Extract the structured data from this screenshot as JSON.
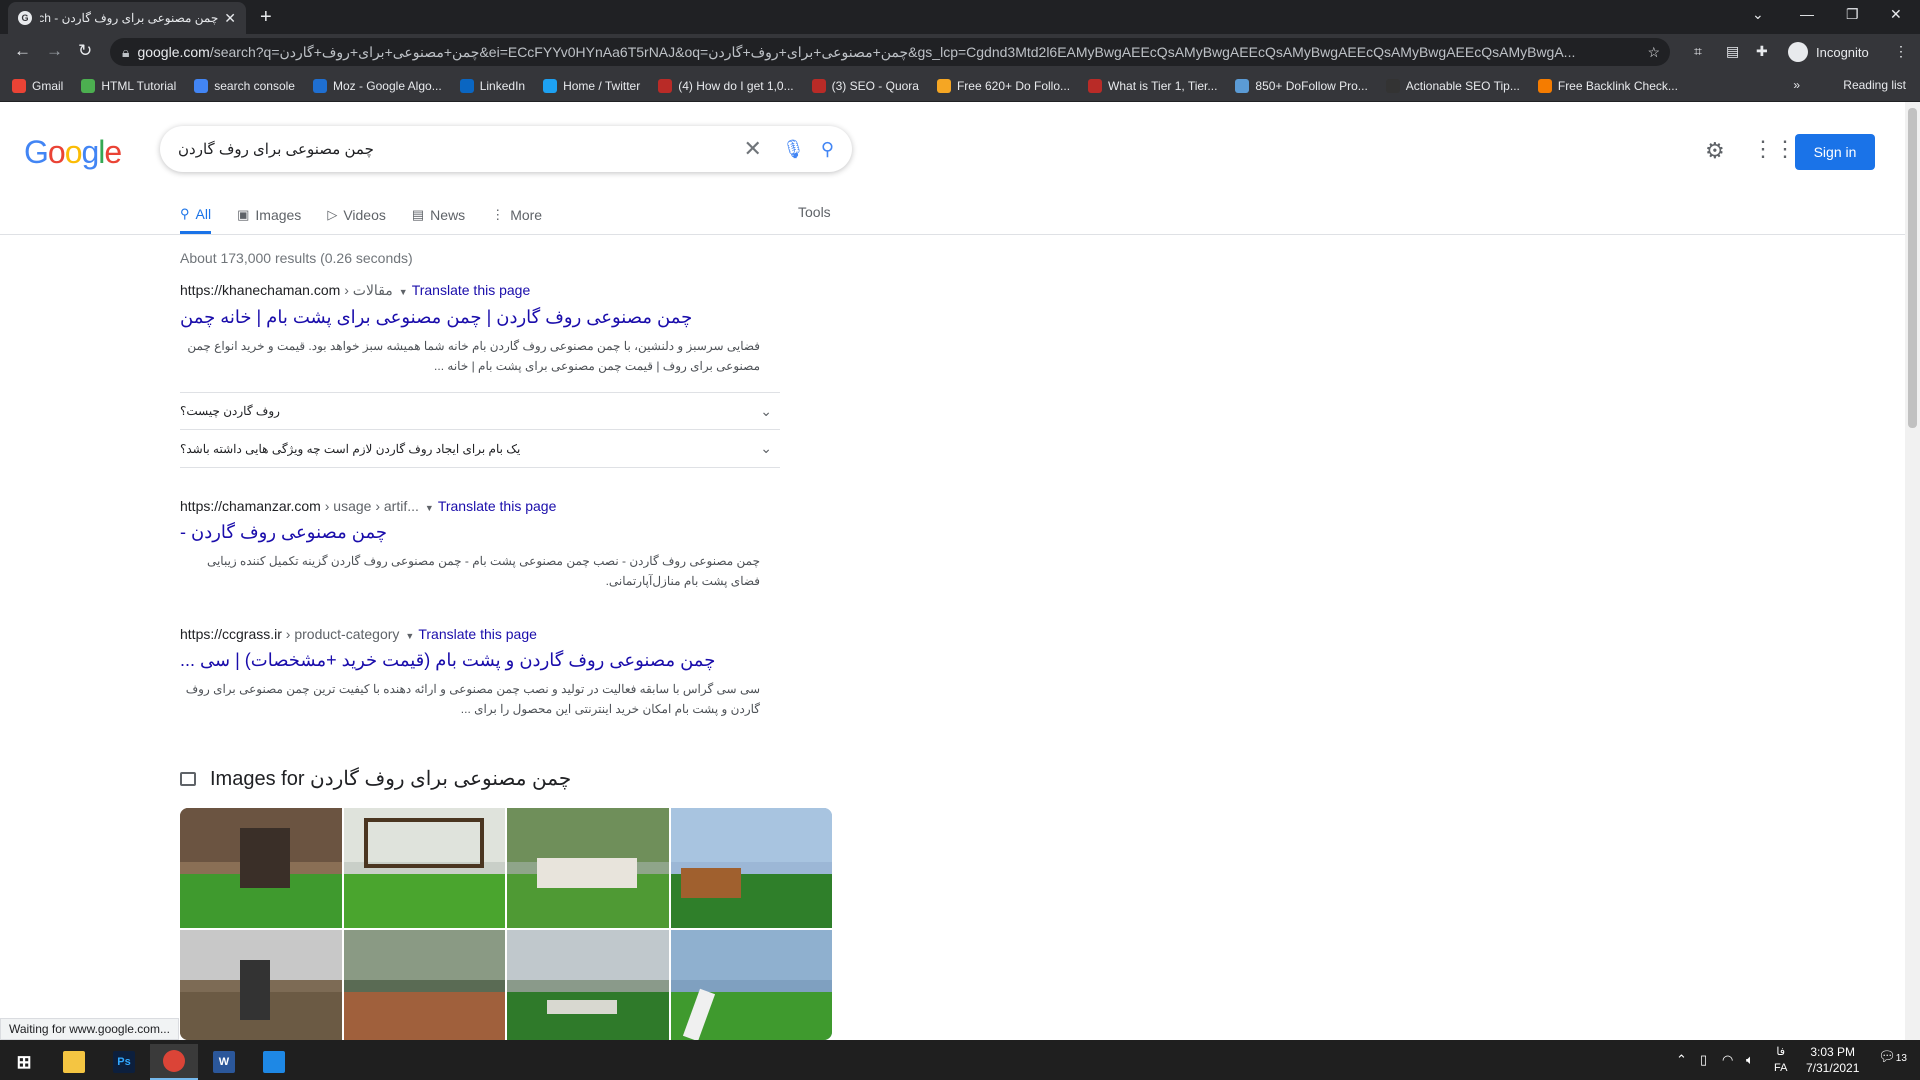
{
  "browser": {
    "tab_title": "چمن مصنوعی برای روف گاردن - ch",
    "tab_close": "✕",
    "new_tab": "+",
    "url_host": "google.com",
    "url_rest": "/search?q=چمن+مصنوعی+برای+روف+گاردن&ei=ECcFYYv0HYnAa6T5rNAJ&oq=چمن+مصنوعی+برای+روف+گاردن&gs_lcp=Cgdnd3Mtd2l6EAMyBwgAEEcQsAMyBwgAEEcQsAMyBwgAEEcQsAMyBwgAEEcQsAMyBwgA...",
    "profile": "Incognito",
    "reading_list": "Reading list",
    "bookmarks": [
      {
        "label": "Gmail",
        "color": "#ea4335"
      },
      {
        "label": "HTML Tutorial",
        "color": "#4caf50"
      },
      {
        "label": "search console",
        "color": "#4285f4"
      },
      {
        "label": "Moz - Google Algo...",
        "color": "#1f6fd1"
      },
      {
        "label": "LinkedIn",
        "color": "#0a66c2"
      },
      {
        "label": "Home / Twitter",
        "color": "#1da1f2"
      },
      {
        "label": "(4) How do I get 1,0...",
        "color": "#b92b27"
      },
      {
        "label": "(3) SEO - Quora",
        "color": "#b92b27"
      },
      {
        "label": "Free 620+ Do Follo...",
        "color": "#f5a623"
      },
      {
        "label": "What is Tier 1, Tier...",
        "color": "#b92b27"
      },
      {
        "label": "850+ DoFollow Pro...",
        "color": "#5b9bd5"
      },
      {
        "label": "Actionable SEO Tip...",
        "color": "#333333"
      },
      {
        "label": "Free Backlink Check...",
        "color": "#f57c00"
      }
    ]
  },
  "google": {
    "logo": "Google",
    "query": "چمن مصنوعی برای روف گاردن",
    "sign_in": "Sign in",
    "tabs": [
      "All",
      "Images",
      "Videos",
      "News",
      "More"
    ],
    "tools": "Tools",
    "stats": "About 173,000 results (0.26 seconds)"
  },
  "results": [
    {
      "site": "https://khanechaman.com",
      "path": " › مقالات",
      "translate": "Translate this page",
      "title": "چمن مصنوعی روف گاردن | چمن مصنوعی برای پشت بام | خانه چمن",
      "snippet": "فضایی سرسبز و دلنشین، با چمن مصنوعی روف گاردن بام خانه شما همیشه سبز خواهد بود. قیمت و خرید انواع چمن مصنوعی برای روف | قیمت چمن مصنوعی برای پشت بام | خانه ..."
    },
    {
      "site": "https://chamanzar.com",
      "path": " › usage › artif...",
      "translate": "Translate this page",
      "title": "چمن مصنوعی روف گاردن -",
      "snippet": "چمن مصنوعی روف گاردن - نصب چمن مصنوعی پشت بام - چمن مصنوعی روف گاردن گزینه تکمیل کننده زیبایی فضای پشت بام منازل‌آپارتمانی."
    },
    {
      "site": "https://ccgrass.ir",
      "path": " › product-category",
      "translate": "Translate this page",
      "title": "چمن مصنوعی روف گاردن و پشت بام (قیمت خرید +مشخصات) | سی ...",
      "snippet": "سی سی گراس با سابقه فعالیت در تولید و نصب چمن مصنوعی و ارائه دهنده با کیفیت ترین چمن مصنوعی برای روف گاردن و پشت بام امکان خرید اینترنتی این محصول را برای ..."
    }
  ],
  "people_also_ask": [
    "روف گاردن چیست؟",
    "یک بام برای ایجاد روف گاردن لازم است چه ویژگی هایی داشته باشد؟"
  ],
  "images_heading": "Images for چمن مصنوعی برای روف گاردن",
  "status_bar": "Waiting for www.google.com...",
  "taskbar": {
    "lang_top": "فا",
    "lang_bottom": "FA",
    "time": "3:03 PM",
    "date": "7/31/2021",
    "notifications": "13"
  }
}
